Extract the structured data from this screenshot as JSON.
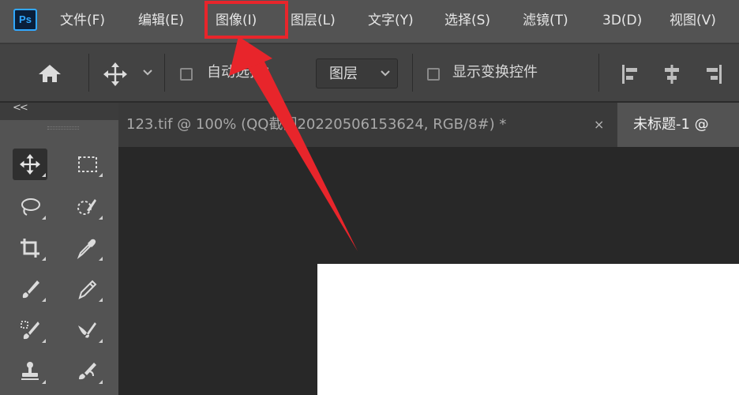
{
  "app": {
    "logo_text": "Ps",
    "brand_color": "#31a8ff"
  },
  "menu": {
    "items": [
      {
        "id": "file",
        "label": "文件(F)"
      },
      {
        "id": "edit",
        "label": "编辑(E)"
      },
      {
        "id": "image",
        "label": "图像(I)"
      },
      {
        "id": "layer",
        "label": "图层(L)"
      },
      {
        "id": "type",
        "label": "文字(Y)"
      },
      {
        "id": "select",
        "label": "选择(S)"
      },
      {
        "id": "filter",
        "label": "滤镜(T)"
      },
      {
        "id": "3d",
        "label": "3D(D)"
      },
      {
        "id": "view",
        "label": "视图(V)"
      }
    ],
    "highlighted_item": "图像(I)",
    "highlight_color": "#e8252b"
  },
  "options_bar": {
    "auto_select_label": "自动选择：",
    "auto_select_checked": false,
    "auto_select_target": "图层",
    "show_transform_label": "显示变换控件",
    "show_transform_checked": false,
    "icons": [
      "home-icon",
      "move-icon",
      "chevron-down-icon",
      "align-left-icon",
      "align-center-icon",
      "align-right-icon"
    ]
  },
  "panel": {
    "collapse_label": "<<"
  },
  "tabs": [
    {
      "label": "123.tif @ 100% (QQ截图20220506153624, RGB/8#) *",
      "active": false,
      "close": "×"
    },
    {
      "label": "未标题-1 @",
      "active": true
    }
  ],
  "tools": [
    {
      "name": "move-tool",
      "icon": "move-icon",
      "active": true
    },
    {
      "name": "marquee-tool",
      "icon": "rect-marquee-icon",
      "active": false
    },
    {
      "name": "lasso-tool",
      "icon": "lasso-icon",
      "active": false
    },
    {
      "name": "quick-select-tool",
      "icon": "quick-select-icon",
      "active": false
    },
    {
      "name": "crop-tool",
      "icon": "crop-icon",
      "active": false
    },
    {
      "name": "eyedropper-tool",
      "icon": "eyedropper-icon",
      "active": false
    },
    {
      "name": "healing-brush-tool",
      "icon": "healing-brush-icon",
      "active": false
    },
    {
      "name": "brush-tool",
      "icon": "pencil-icon",
      "active": false
    },
    {
      "name": "clone-stamp-tool",
      "icon": "clone-stamp-icon",
      "active": false
    },
    {
      "name": "mixer-brush-tool",
      "icon": "mixer-brush-icon",
      "active": false
    },
    {
      "name": "stamp-tool",
      "icon": "stamp-icon",
      "active": false
    },
    {
      "name": "history-brush-tool",
      "icon": "history-brush-icon",
      "active": false
    }
  ],
  "annotation": {
    "arrow_color": "#e8252b"
  }
}
